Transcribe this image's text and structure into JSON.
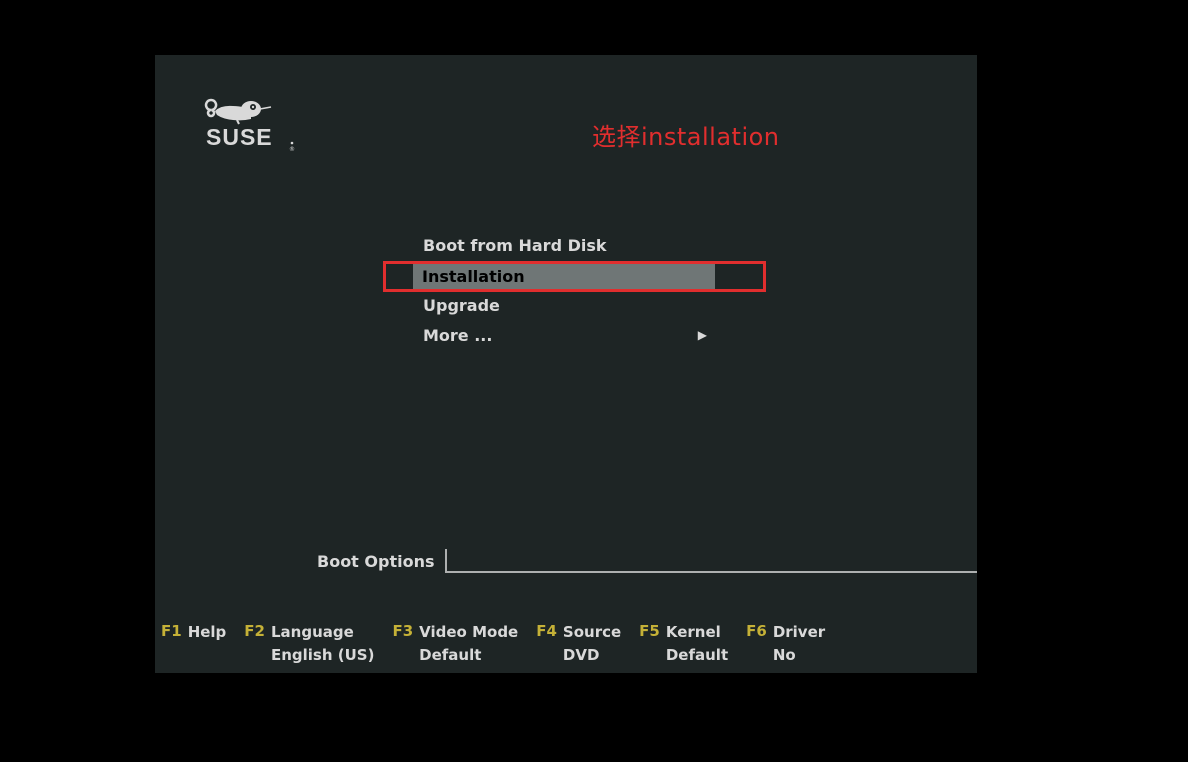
{
  "logo_text": "SUSE",
  "annotation": "选择installation",
  "menu": {
    "items": [
      {
        "label": "Boot from Hard Disk",
        "selected": false
      },
      {
        "label": "Installation",
        "selected": true
      },
      {
        "label": "Upgrade",
        "selected": false
      },
      {
        "label": "More ...",
        "selected": false,
        "has_submenu": true
      }
    ]
  },
  "boot_options": {
    "label": "Boot Options",
    "value": ""
  },
  "fkeys": [
    {
      "key": "F1",
      "label": "Help",
      "value": ""
    },
    {
      "key": "F2",
      "label": "Language",
      "value": "English (US)"
    },
    {
      "key": "F3",
      "label": "Video Mode",
      "value": "Default"
    },
    {
      "key": "F4",
      "label": "Source",
      "value": "DVD"
    },
    {
      "key": "F5",
      "label": "Kernel",
      "value": "Default"
    },
    {
      "key": "F6",
      "label": "Driver",
      "value": "No"
    }
  ],
  "icons": {
    "submenu_arrow": "▶"
  }
}
